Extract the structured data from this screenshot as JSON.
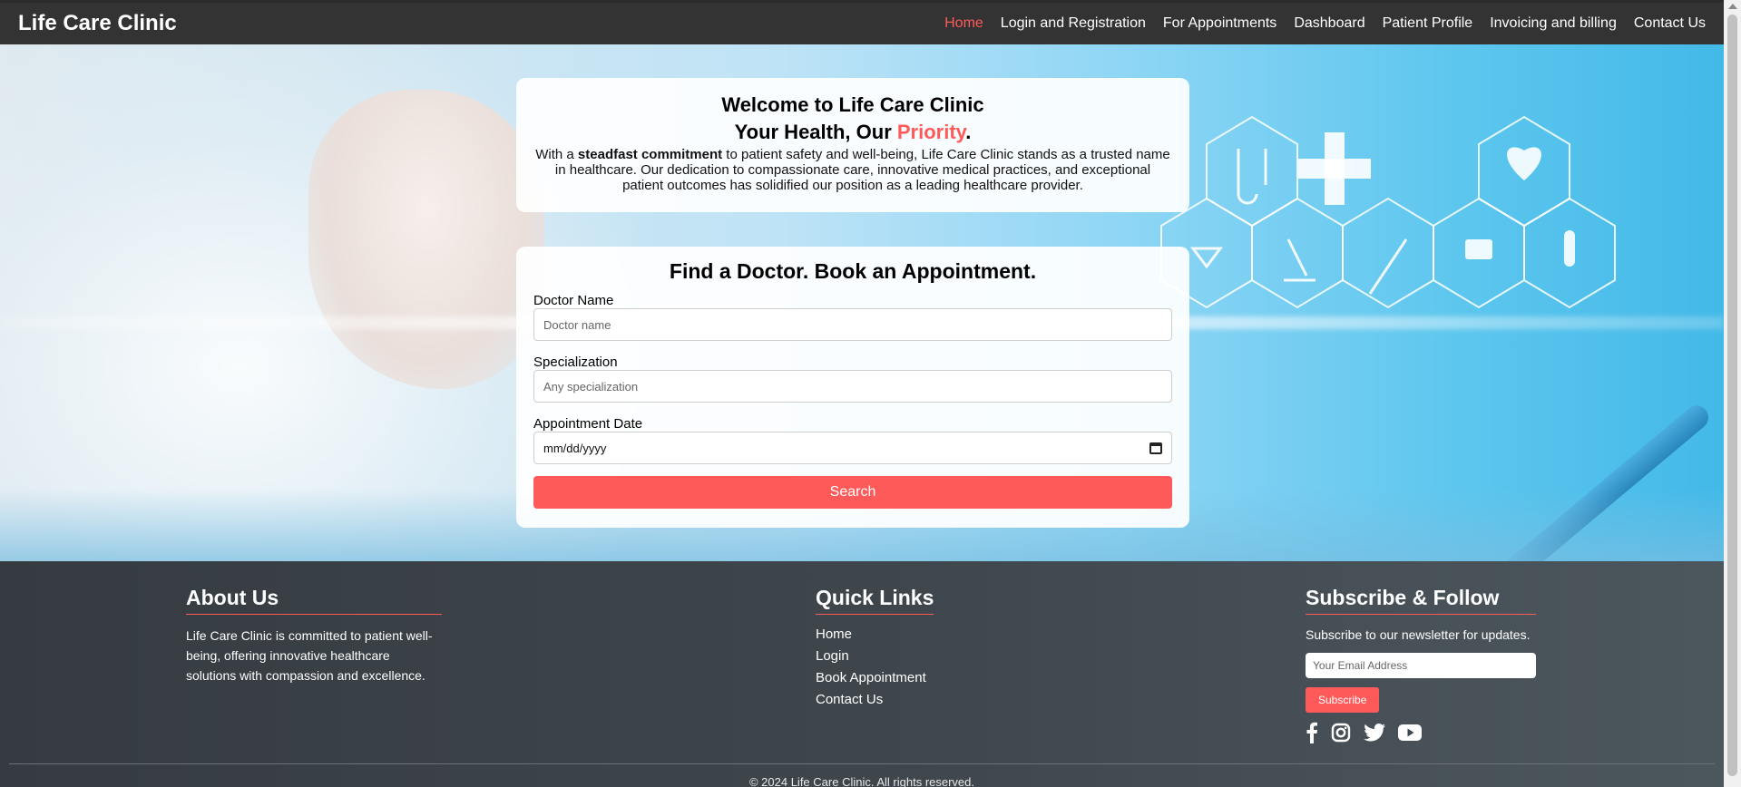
{
  "navbar": {
    "brand": "Life Care Clinic",
    "links": [
      {
        "label": "Home",
        "active": true
      },
      {
        "label": "Login and Registration"
      },
      {
        "label": "For Appointments"
      },
      {
        "label": "Dashboard"
      },
      {
        "label": "Patient Profile"
      },
      {
        "label": "Invoicing and billing"
      },
      {
        "label": "Contact Us"
      }
    ]
  },
  "welcome": {
    "title": "Welcome to Life Care Clinic",
    "subtitle_prefix": "Your Health, Our ",
    "subtitle_accent": "Priority",
    "subtitle_suffix": ".",
    "text_prefix": "With a ",
    "text_bold": "steadfast commitment",
    "text_rest": " to patient safety and well-being, Life Care Clinic stands as a trusted name in healthcare. Our dedication to compassionate care, innovative medical practices, and exceptional patient outcomes has solidified our position as a leading healthcare provider."
  },
  "search": {
    "title": "Find a Doctor. Book an Appointment.",
    "doctor_label": "Doctor Name",
    "doctor_placeholder": "Doctor name",
    "specialization_label": "Specialization",
    "specialization_placeholder": "Any specialization",
    "date_label": "Appointment Date",
    "date_value": "mm/dd/yyyy",
    "button_label": "Search"
  },
  "footer": {
    "about": {
      "heading": "About Us",
      "text": "Life Care Clinic is committed to patient well-being, offering innovative healthcare solutions with compassion and excellence."
    },
    "quick_links": {
      "heading": "Quick Links",
      "items": [
        "Home",
        "Login",
        "Book Appointment",
        "Contact Us"
      ]
    },
    "subscribe": {
      "heading": "Subscribe & Follow",
      "text": "Subscribe to our newsletter for updates.",
      "email_placeholder": "Your Email Address",
      "button_label": "Subscribe",
      "socials": [
        "facebook-icon",
        "instagram-icon",
        "twitter-icon",
        "youtube-icon"
      ]
    },
    "copyright": "© 2024 Life Care Clinic. All rights reserved."
  },
  "colors": {
    "accent": "#ff5a5a",
    "navbar_bg": "#333333",
    "footer_bg": "#3e464c"
  }
}
